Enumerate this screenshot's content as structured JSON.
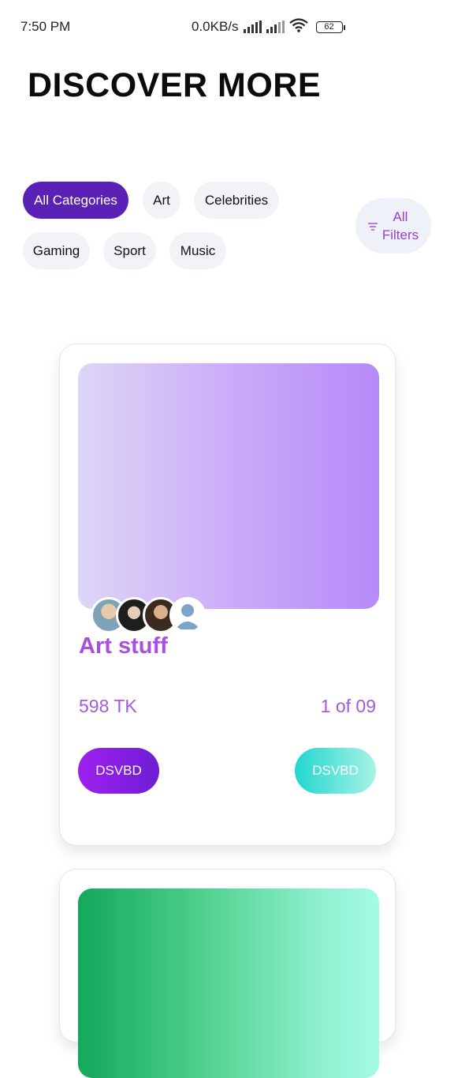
{
  "status_bar": {
    "time": "7:50 PM",
    "network_speed": "0.0KB/s",
    "battery": "62",
    "icons": [
      "signal-icon",
      "signal-weak-icon",
      "wifi-icon",
      "battery-icon"
    ]
  },
  "header": {
    "title": "DISCOVER MORE"
  },
  "categories": {
    "chips": [
      {
        "label": "All Categories",
        "active": true
      },
      {
        "label": "Art",
        "active": false
      },
      {
        "label": "Celebrities",
        "active": false
      },
      {
        "label": "Gaming",
        "active": false
      },
      {
        "label": "Sport",
        "active": false
      },
      {
        "label": "Music",
        "active": false
      }
    ],
    "filters_line1": "All",
    "filters_line2": "Filters",
    "filters_icon": "filter-icon"
  },
  "cards": [
    {
      "title": "Art stuff",
      "price": "598 TK",
      "count": "1 of 09",
      "primary_button": "DSVBD",
      "secondary_button": "DSVBD",
      "avatars": [
        "avatar-1",
        "avatar-2",
        "avatar-3",
        "avatar-placeholder-icon"
      ]
    }
  ],
  "colors": {
    "accent": "#5b21b6",
    "title_purple": "#a94fe0",
    "primary_gradient_start": "#a020f0",
    "secondary_gradient_start": "#22d6cf"
  }
}
